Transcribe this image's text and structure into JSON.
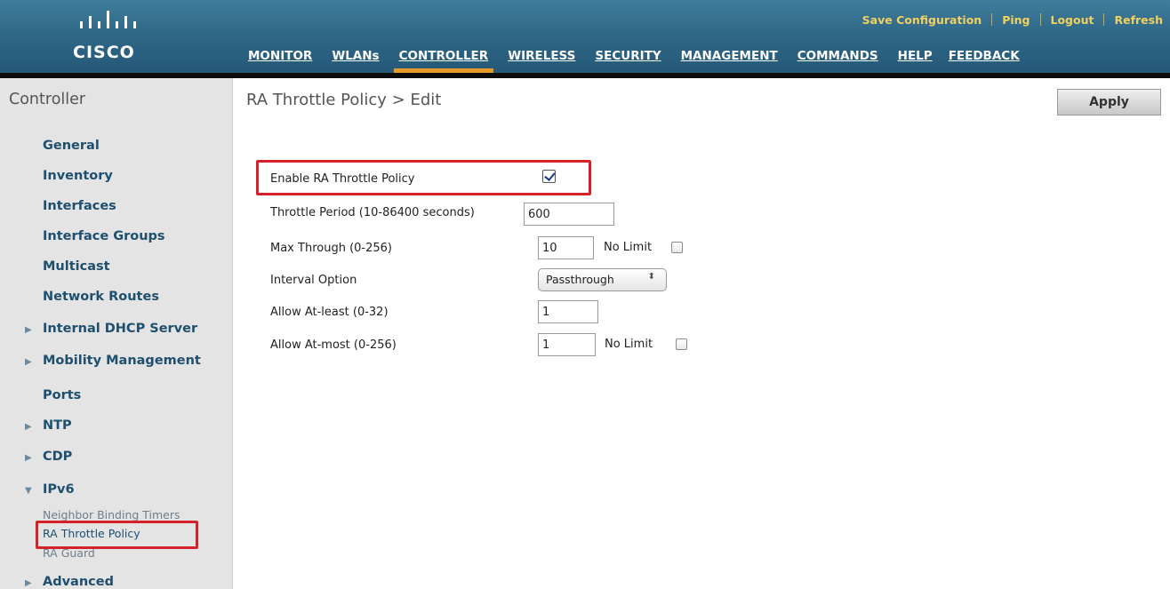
{
  "header": {
    "brand": "CISCO",
    "utility_links": [
      "Save Configuration",
      "Ping",
      "Logout",
      "Refresh"
    ],
    "nav": [
      "MONITOR",
      "WLANs",
      "CONTROLLER",
      "WIRELESS",
      "SECURITY",
      "MANAGEMENT",
      "COMMANDS",
      "HELP",
      "FEEDBACK"
    ],
    "active_nav": "CONTROLLER",
    "active_color": "#e69a2a",
    "bar_color": "#2f6786"
  },
  "sidebar": {
    "title": "Controller",
    "items": [
      {
        "label": "General",
        "expandable": false
      },
      {
        "label": "Inventory",
        "expandable": false
      },
      {
        "label": "Interfaces",
        "expandable": false
      },
      {
        "label": "Interface Groups",
        "expandable": false
      },
      {
        "label": "Multicast",
        "expandable": false
      },
      {
        "label": "Network Routes",
        "expandable": false
      },
      {
        "label": "Internal DHCP Server",
        "expandable": true,
        "icon": "triangle-right-icon"
      },
      {
        "label": "Mobility Management",
        "expandable": true,
        "icon": "triangle-right-icon"
      },
      {
        "label": "Ports",
        "expandable": false
      },
      {
        "label": "NTP",
        "expandable": true,
        "icon": "triangle-right-icon"
      },
      {
        "label": "CDP",
        "expandable": true,
        "icon": "triangle-right-icon"
      },
      {
        "label": "IPv6",
        "expandable": true,
        "expanded": true,
        "icon": "triangle-down-icon"
      },
      {
        "label": "Advanced",
        "expandable": true,
        "icon": "triangle-right-icon"
      }
    ],
    "ipv6_subitems": [
      {
        "label": "Neighbor Binding Timers",
        "selected": false
      },
      {
        "label": "RA Throttle Policy",
        "selected": true
      },
      {
        "label": "RA Guard",
        "selected": false
      }
    ]
  },
  "main": {
    "title": "RA Throttle Policy > Edit",
    "apply_label": "Apply",
    "form": {
      "enable_label": "Enable RA Throttle Policy",
      "enable_checked": true,
      "throttle_period_label": "Throttle Period (10-86400 seconds)",
      "throttle_period_value": "600",
      "max_through_label": "Max Through (0-256)",
      "max_through_value": "10",
      "no_limit_label": "No Limit",
      "max_through_no_limit": false,
      "interval_option_label": "Interval Option",
      "interval_option_value": "Passthrough",
      "allow_at_least_label": "Allow At-least (0-32)",
      "allow_at_least_value": "1",
      "allow_at_most_label": "Allow At-most (0-256)",
      "allow_at_most_value": "1",
      "allow_at_most_no_limit": false
    },
    "highlight_color": "#d4222a"
  }
}
